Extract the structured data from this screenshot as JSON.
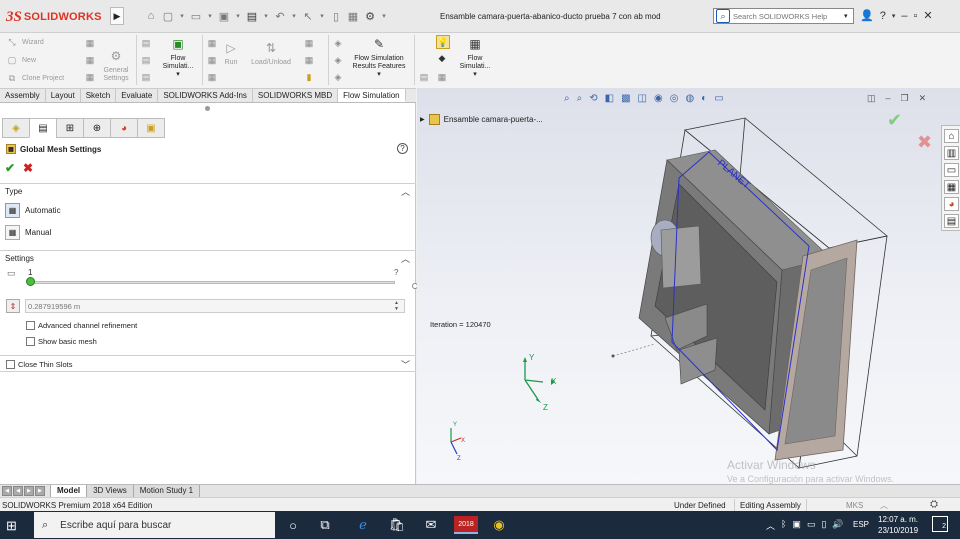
{
  "app": {
    "logo_mark": "3S",
    "logo_text": "SOLIDWORKS",
    "doc_title": "Ensamble camara-puerta-abanico-ducto prueba 7 con ab mod",
    "help_search_placeholder": "Search SOLIDWORKS Help"
  },
  "ribbon": {
    "wizard": "Wizard",
    "new": "New",
    "clone_project": "Clone Project",
    "general_settings": "General Settings",
    "flow_simulation_1": "Flow Simulati...",
    "run": "Run",
    "load_unload": "Load/Unload",
    "results_features": "Flow Simulation Results Features",
    "flow_simulation_2": "Flow Simulati..."
  },
  "command_tabs": [
    {
      "label": "Assembly",
      "active": false
    },
    {
      "label": "Layout",
      "active": false
    },
    {
      "label": "Sketch",
      "active": false
    },
    {
      "label": "Evaluate",
      "active": false
    },
    {
      "label": "SOLIDWORKS Add-Ins",
      "active": false
    },
    {
      "label": "SOLIDWORKS MBD",
      "active": false
    },
    {
      "label": "Flow Simulation",
      "active": true
    }
  ],
  "property_manager": {
    "title": "Global Mesh Settings",
    "type_group": "Type",
    "type_automatic": "Automatic",
    "type_manual": "Manual",
    "settings_group": "Settings",
    "level_value": "1",
    "level_hint": "?",
    "level_fraction": 0.0,
    "min_gap_value": "0.287919596 m",
    "advanced_channel": "Advanced channel refinement",
    "show_basic_mesh": "Show basic mesh",
    "close_thin_slots": "Close Thin Slots"
  },
  "viewport": {
    "tree_item": "Ensamble camara-puerta-...",
    "iteration": "Iteration = 120470",
    "model_label": "PLANET",
    "axis_y": "Y",
    "axis_x": "X",
    "axis_z": "Z",
    "watermark_title": "Activar Windows",
    "watermark_sub": "Ve a Configuración para activar Windows."
  },
  "bottom_tabs": [
    {
      "label": "Model",
      "active": true
    },
    {
      "label": "3D Views",
      "active": false
    },
    {
      "label": "Motion Study 1",
      "active": false
    }
  ],
  "status": {
    "edition": "SOLIDWORKS Premium 2018 x64 Edition",
    "definition": "Under Defined",
    "mode": "Editing Assembly",
    "units": "MKS"
  },
  "taskbar": {
    "search_placeholder": "Escribe aquí para buscar",
    "sw_badge": "2018",
    "language": "ESP",
    "time": "12:07 a. m.",
    "date": "23/10/2019",
    "notifications": "2"
  },
  "colors": {
    "accent": "#d32f2f",
    "taskbar": "#1b2a3c",
    "ok_green": "#2a9a2a",
    "cancel_red": "#d02020"
  }
}
